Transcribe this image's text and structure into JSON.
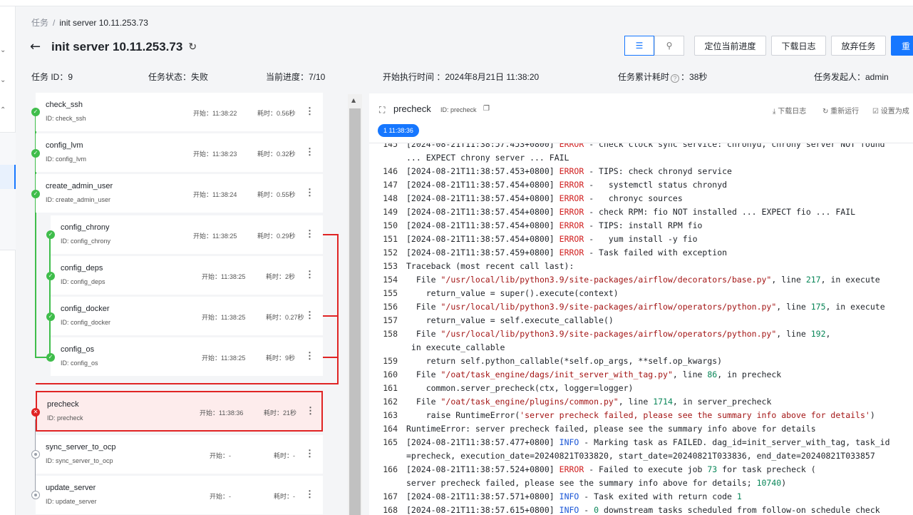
{
  "breadcrumb": {
    "parent": "任务",
    "current": "init server 10.11.253.73"
  },
  "page_title": "init server 10.11.253.73",
  "actions": {
    "locate": "定位当前进度",
    "download": "下载日志",
    "abandon": "放弃任务",
    "retry": "重"
  },
  "info": {
    "task_id": "任务 ID：9",
    "task_status": "任务状态：失败",
    "progress": "当前进度：7/10",
    "start_time": "开始执行时间 ：2024年8月21日 11:38:20",
    "elapsed_label": "任务累计耗时",
    "elapsed_value": "：38秒",
    "initiator": "任务发起人：admin"
  },
  "tasks": [
    {
      "name": "check_ssh",
      "id": "ID: check_ssh",
      "start": "开始：11:38:22",
      "duration": "耗时：0.56秒",
      "status": "success"
    },
    {
      "name": "config_lvm",
      "id": "ID: config_lvm",
      "start": "开始：11:38:23",
      "duration": "耗时：0.32秒",
      "status": "success"
    },
    {
      "name": "create_admin_user",
      "id": "ID: create_admin_user",
      "start": "开始：11:38:24",
      "duration": "耗时：0.55秒",
      "status": "success"
    },
    {
      "name": "config_chrony",
      "id": "ID: config_chrony",
      "start": "开始：11:38:25",
      "duration": "耗时：0.29秒",
      "status": "success"
    },
    {
      "name": "config_deps",
      "id": "ID: config_deps",
      "start": "开始：11:38:25",
      "duration": "耗时：2秒",
      "status": "success"
    },
    {
      "name": "config_docker",
      "id": "ID: config_docker",
      "start": "开始：11:38:25",
      "duration": "耗时：0.27秒",
      "status": "success"
    },
    {
      "name": "config_os",
      "id": "ID: config_os",
      "start": "开始：11:38:25",
      "duration": "耗时：9秒",
      "status": "success"
    },
    {
      "name": "precheck",
      "id": "ID: precheck",
      "start": "开始：11:38:36",
      "duration": "耗时：21秒",
      "status": "failed"
    },
    {
      "name": "sync_server_to_ocp",
      "id": "ID: sync_server_to_ocp",
      "start": "开始：-",
      "duration": "耗时：-",
      "status": "pending"
    },
    {
      "name": "update_server",
      "id": "ID: update_server",
      "start": "开始：-",
      "duration": "耗时：-",
      "status": "pending"
    }
  ],
  "log_panel": {
    "title": "precheck",
    "id": "ID: precheck",
    "download": "下载日志",
    "rerun": "重新运行",
    "set_success": "设置为成",
    "time_pill": "1 11:38:36"
  },
  "colors": {
    "accent": "#1677ff",
    "success": "#3fbd4b",
    "error": "#e02424"
  }
}
